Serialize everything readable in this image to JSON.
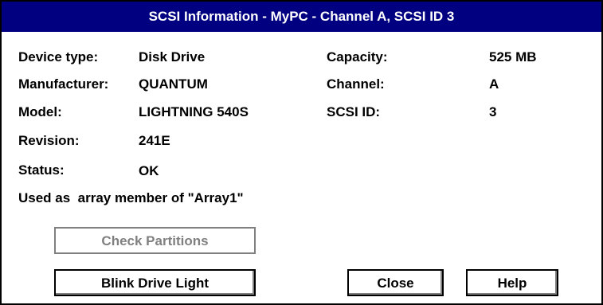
{
  "window": {
    "title": "SCSI Information - MyPC - Channel A, SCSI ID 3"
  },
  "fields": {
    "device_type": {
      "label": "Device type:",
      "value": "Disk Drive"
    },
    "manufacturer": {
      "label": "Manufacturer:",
      "value": "QUANTUM"
    },
    "model": {
      "label": "Model:",
      "value": "LIGHTNING 540S"
    },
    "revision": {
      "label": "Revision:",
      "value": "241E"
    },
    "status": {
      "label": "Status:",
      "value": "OK"
    },
    "capacity": {
      "label": "Capacity:",
      "value": "525 MB"
    },
    "channel": {
      "label": "Channel:",
      "value": "A"
    },
    "scsi_id": {
      "label": "SCSI ID:",
      "value": "3"
    }
  },
  "array_note": "Used as  array member of \"Array1\"",
  "buttons": {
    "check_partitions": "Check Partitions",
    "blink_drive_light": "Blink Drive Light",
    "close": "Close",
    "help": "Help"
  },
  "colors": {
    "titlebar": "#000080",
    "disabled_text": "#808080"
  }
}
